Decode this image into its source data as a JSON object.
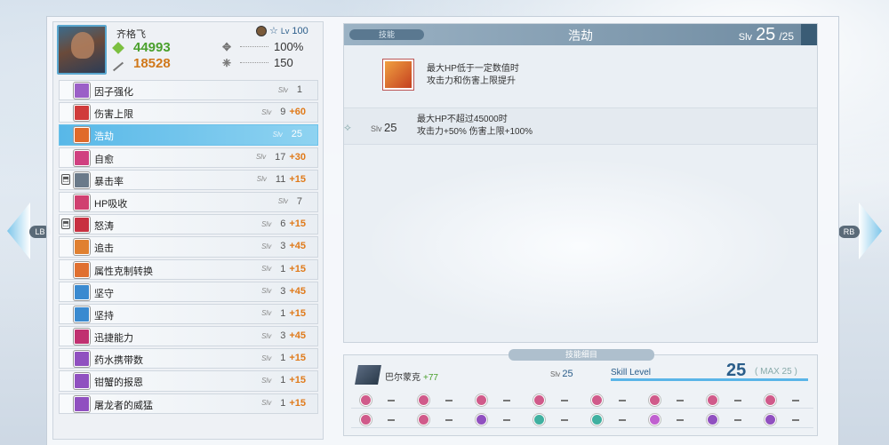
{
  "character": {
    "name": "齐格飞",
    "level_prefix": "Lv",
    "level": "100",
    "atk": "44993",
    "hp": "18528",
    "stat1": "100%",
    "stat2": "150"
  },
  "skills": [
    {
      "name": "因子强化",
      "lv": "1",
      "plus": "",
      "color": "#9b5fc7",
      "lock": false
    },
    {
      "name": "伤害上限",
      "lv": "9",
      "plus": "+60",
      "color": "#d03b3b",
      "lock": false
    },
    {
      "name": "浩劫",
      "lv": "25",
      "plus": "",
      "color": "#e06a2a",
      "lock": false
    },
    {
      "name": "自愈",
      "lv": "17",
      "plus": "+30",
      "color": "#d04080",
      "lock": false
    },
    {
      "name": "暴击率",
      "lv": "11",
      "plus": "+15",
      "color": "#6a7a8a",
      "lock": true
    },
    {
      "name": "HP吸收",
      "lv": "7",
      "plus": "",
      "color": "#d04070",
      "lock": false
    },
    {
      "name": "怒涛",
      "lv": "6",
      "plus": "+15",
      "color": "#c83040",
      "lock": true
    },
    {
      "name": "追击",
      "lv": "3",
      "plus": "+45",
      "color": "#e08030",
      "lock": false
    },
    {
      "name": "属性克制转换",
      "lv": "1",
      "plus": "+15",
      "color": "#e07030",
      "lock": false
    },
    {
      "name": "坚守",
      "lv": "3",
      "plus": "+45",
      "color": "#3a8ad0",
      "lock": false
    },
    {
      "name": "坚持",
      "lv": "1",
      "plus": "+15",
      "color": "#3a8ad0",
      "lock": false
    },
    {
      "name": "迅捷能力",
      "lv": "3",
      "plus": "+45",
      "color": "#c03070",
      "lock": false
    },
    {
      "name": "药水携带数",
      "lv": "1",
      "plus": "+15",
      "color": "#9050c0",
      "lock": false
    },
    {
      "name": "钳蟹的报恩",
      "lv": "1",
      "plus": "+15",
      "color": "#9050c0",
      "lock": false
    },
    {
      "name": "屠龙者的威猛",
      "lv": "1",
      "plus": "+15",
      "color": "#9050c0",
      "lock": false
    }
  ],
  "slv_label": "Slv",
  "detail": {
    "tag": "技能",
    "title": "浩劫",
    "lv": "25",
    "max": "/25",
    "desc_line1": "最大HP低于一定数值时",
    "desc_line2": "攻击力和伤害上限提升",
    "row_lv": "25",
    "row_line1": "最大HP不超过45000时",
    "row_line2": "攻击力+50% 伤害上限+100%"
  },
  "bottom": {
    "title": "技能细目",
    "material": "巴尔蒙克",
    "material_bonus": "+77",
    "slv": "25",
    "skill_level_label": "Skill Level",
    "level": "25",
    "max": "( MAX 25 )",
    "row1_colors": [
      "#d05a8a",
      "#d05a8a",
      "#d05a8a",
      "#d05a8a",
      "#d05a8a",
      "#d05a8a",
      "#d05a8a",
      "#d05a8a"
    ],
    "row2_colors": [
      "#d05a8a",
      "#d05a8a",
      "#9050c0",
      "#40b0a0",
      "#40b0a0",
      "#c060d0",
      "#9050c0",
      "#9050c0"
    ]
  },
  "nav": {
    "left": "LB",
    "right": "RB"
  }
}
